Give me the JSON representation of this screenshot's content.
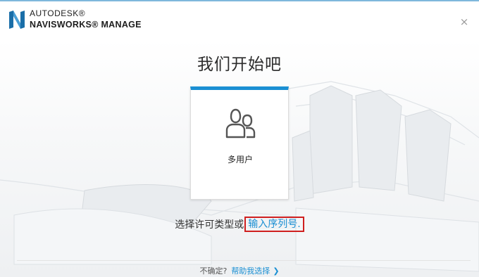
{
  "header": {
    "brand_line1": "AUTODESK®",
    "brand_line2": "NAVISWORKS® MANAGE",
    "close_glyph": "×"
  },
  "main": {
    "title": "我们开始吧",
    "card_label": "多用户",
    "card_icon": "multi-user-icon",
    "choose_text": "选择许可类型或",
    "serial_link": "输入序列号."
  },
  "footer": {
    "unsure_text": "不确定?",
    "help_link": "帮助我选择",
    "chevron_glyph": "❯"
  },
  "colors": {
    "accent": "#1a8fd3",
    "highlight_border": "#cf1f1f"
  }
}
